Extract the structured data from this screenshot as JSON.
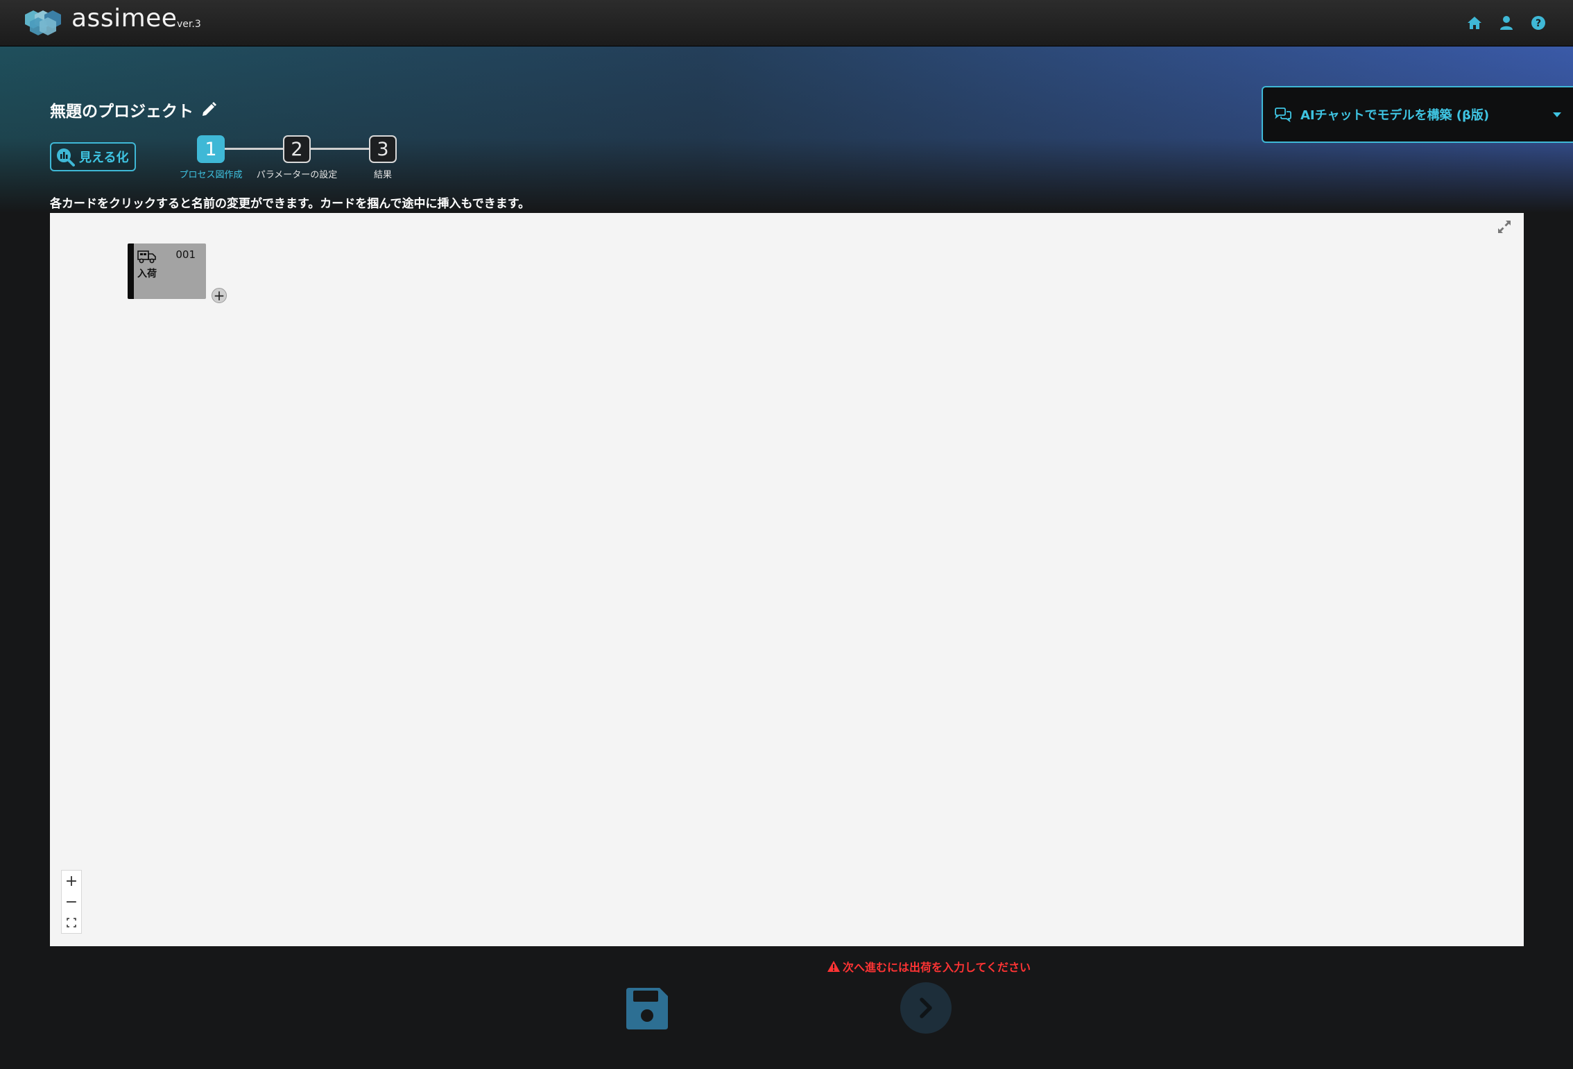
{
  "app": {
    "brand": "assimee",
    "version": "ver.3"
  },
  "nav_icons": [
    "home-icon",
    "user-icon",
    "help-icon"
  ],
  "project": {
    "title": "無題のプロジェクト"
  },
  "visualize_button": {
    "label": "見える化"
  },
  "stepper": [
    {
      "number": "1",
      "label": "プロセス図作成",
      "active": true
    },
    {
      "number": "2",
      "label": "パラメーターの設定",
      "active": false
    },
    {
      "number": "3",
      "label": "結果",
      "active": false
    }
  ],
  "instruction": "各カードをクリックすると名前の変更ができます。カードを掴んで途中に挿入もできます。",
  "ai_chat": {
    "label": "AIチャットでモデルを構築 (β版)"
  },
  "canvas": {
    "cards": [
      {
        "id": "001",
        "name": "入荷",
        "icon": "truck-icon"
      }
    ],
    "add_button_label": "+",
    "zoom_in_label": "+",
    "zoom_out_label": "−"
  },
  "footer": {
    "warning": "次へ進むには出荷を入力してください"
  },
  "colors": {
    "accent": "#3fb8d6",
    "warning": "#ff3434",
    "background": "#161718",
    "canvas": "#f4f4f4"
  }
}
